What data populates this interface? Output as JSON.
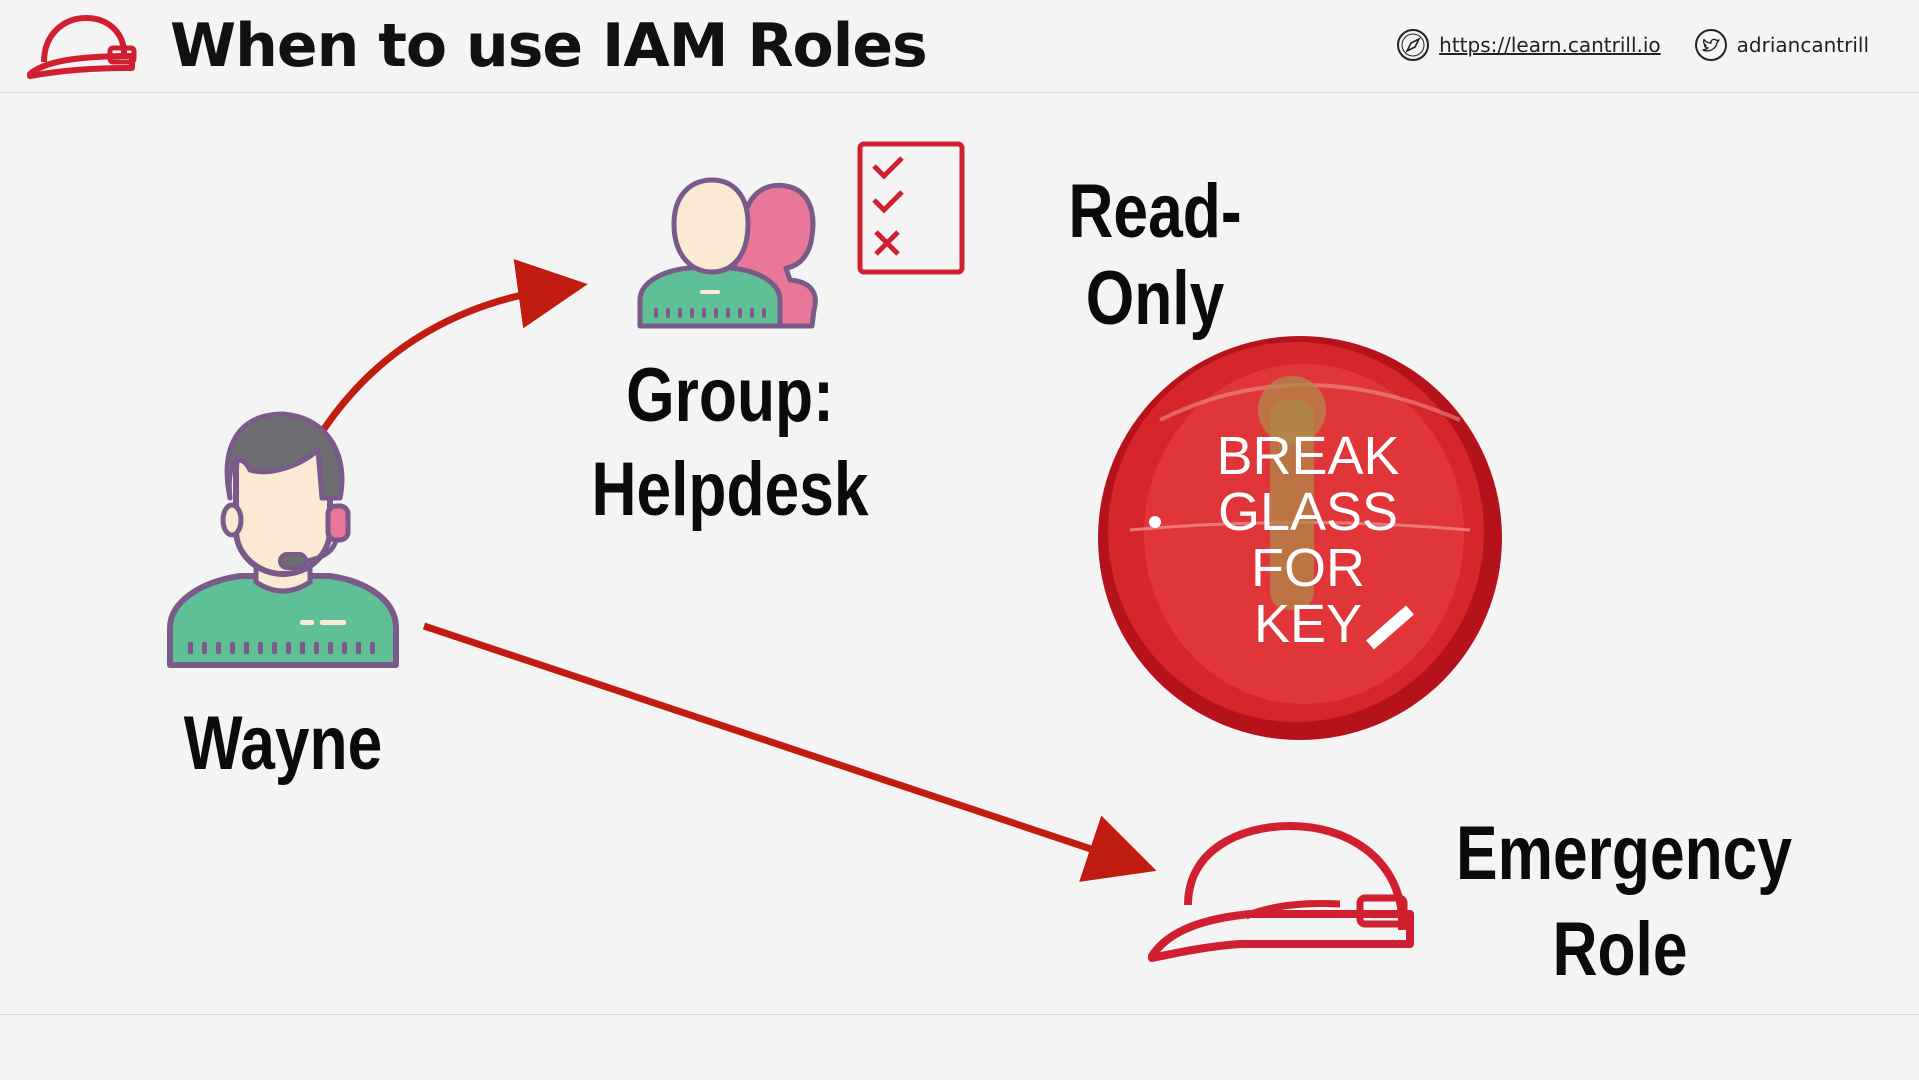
{
  "header": {
    "title": "When to use IAM Roles",
    "website": "https://learn.cantrill.io",
    "twitter": "adriancantrill",
    "logo_icon": "hardhat-icon",
    "compass_icon": "compass-icon",
    "twitter_icon": "twitter-icon"
  },
  "diagram": {
    "user_label": "Wayne",
    "group_label_line1": "Group:",
    "group_label_line2": "Helpdesk",
    "policy_label": "Read-Only",
    "role_label_line1": "Emergency",
    "role_label_line2": "Role",
    "break_glass_lines": [
      "BREAK",
      "GLASS",
      "FOR",
      "KEY"
    ]
  },
  "colors": {
    "accent": "#d0202f",
    "arrow": "#c01c10",
    "user_shirt": "#5fbf96",
    "user_outline": "#7a5a8a",
    "skin": "#faead4",
    "hair": "#6e6e72",
    "group_back": "#e8779a"
  }
}
